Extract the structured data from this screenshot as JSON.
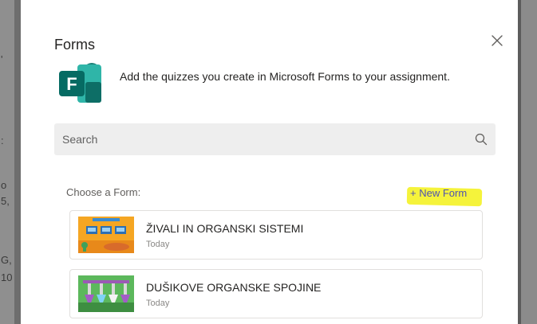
{
  "background": {
    "left_fragments": [
      "'",
      ":",
      "o",
      "5,",
      "G,",
      "10"
    ]
  },
  "dialog": {
    "title": "Forms",
    "close_icon": "close-icon",
    "logo_icon": "microsoft-forms-logo",
    "description": "Add the quizzes you create in Microsoft Forms to your assignment.",
    "search": {
      "placeholder": "Search",
      "value": "",
      "icon": "search-icon"
    },
    "choose_label": "Choose a Form:",
    "new_form_label": "+ New Form",
    "highlight_color": "#f4f230",
    "accent_color": "#4f52b2",
    "forms": [
      {
        "title": "ŽIVALI IN ORGANSKI SISTEMI",
        "date": "Today"
      },
      {
        "title": "DUŠIKOVE ORGANSKE SPOJINE",
        "date": "Today"
      }
    ]
  }
}
